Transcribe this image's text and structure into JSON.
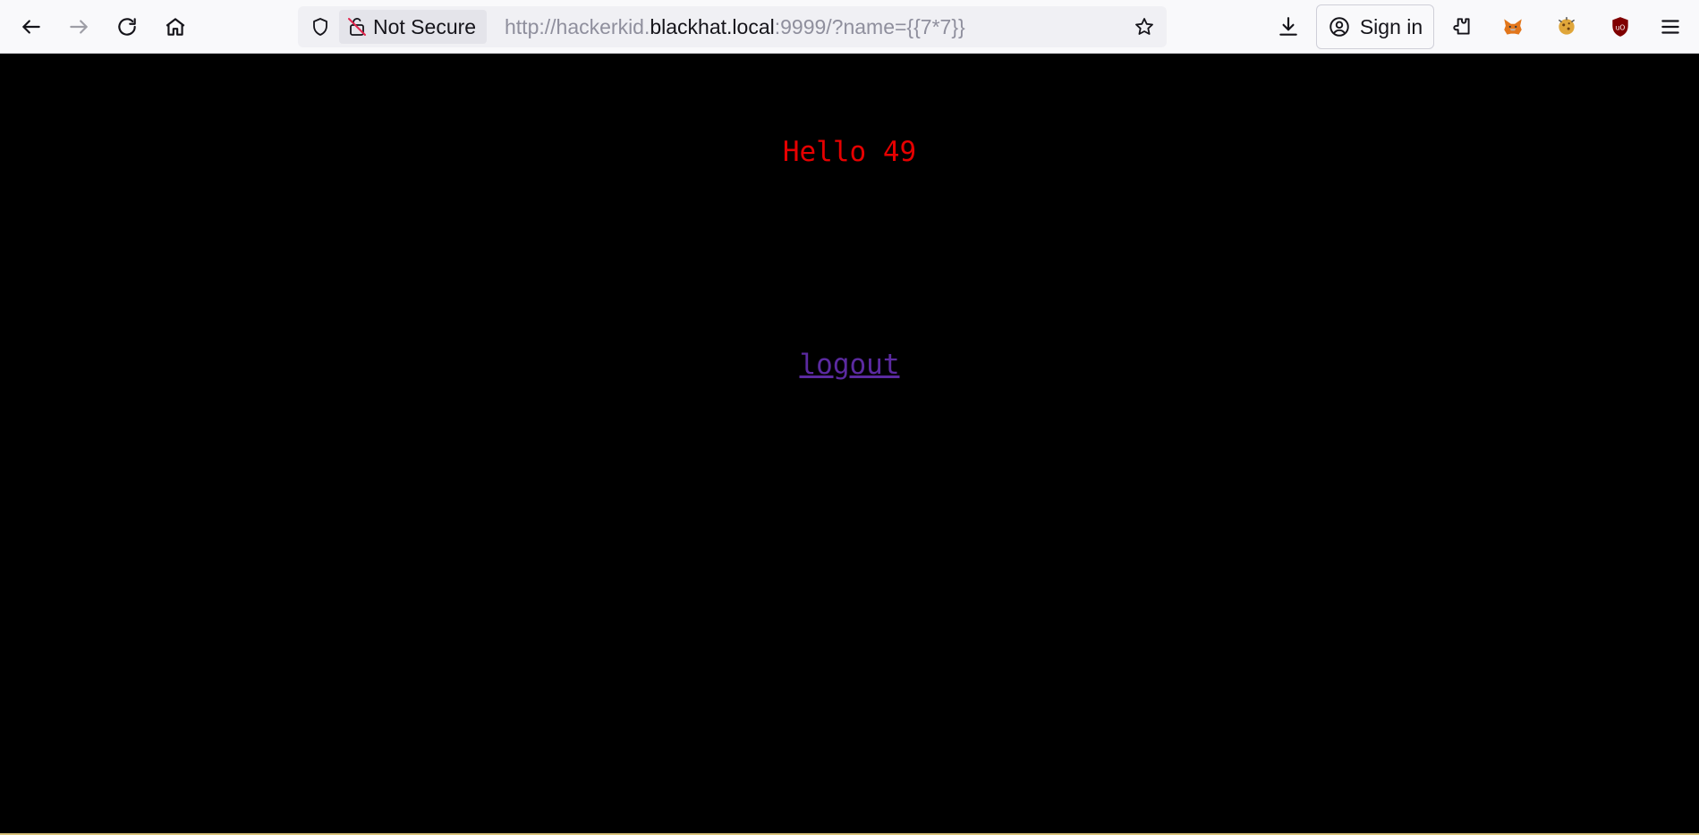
{
  "browser": {
    "security_label": "Not Secure",
    "url_prefix": "http://hackerkid.",
    "url_host": "blackhat.local",
    "url_suffix": ":9999/?name={{7*7}}",
    "sign_in_label": "Sign in",
    "icons": {
      "back": "back-arrow-icon",
      "forward": "forward-arrow-icon",
      "reload": "reload-icon",
      "home": "home-icon",
      "tracking": "shield-icon",
      "insecure": "insecure-lock-icon",
      "bookmark": "star-icon",
      "downloads": "download-icon",
      "account": "account-icon",
      "extensions": "puzzle-icon",
      "metamask": "fox-extension-icon",
      "cookie": "cookie-extension-icon",
      "ublock": "ublock-origin-icon",
      "menu": "hamburger-menu-icon"
    }
  },
  "page": {
    "greeting": "Hello 49",
    "logout_label": "logout",
    "colors": {
      "background": "#000000",
      "greeting": "#e60000",
      "link": "#5b2aa0"
    }
  }
}
